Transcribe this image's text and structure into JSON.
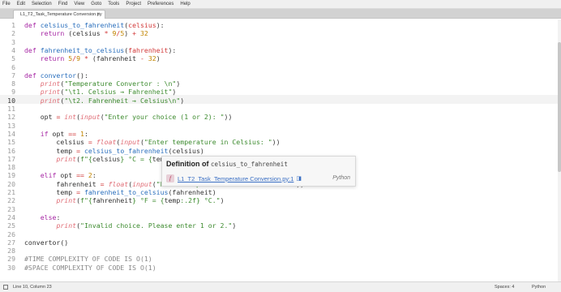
{
  "menu": [
    "File",
    "Edit",
    "Selection",
    "Find",
    "View",
    "Goto",
    "Tools",
    "Project",
    "Preferences",
    "Help"
  ],
  "tab": {
    "label": "L1_T2_Task_Temperature Conversion.py",
    "close": "×"
  },
  "tab_dropdown": "▾",
  "current_line": 10,
  "lines": [
    [
      [
        "kw",
        "def "
      ],
      [
        "fn",
        "celsius_to_fahrenheit"
      ],
      [
        "pl",
        "("
      ],
      [
        "op",
        "celsius"
      ],
      [
        "pl",
        "):"
      ]
    ],
    [
      [
        "pl",
        "    "
      ],
      [
        "kw",
        "return "
      ],
      [
        "pl",
        "(celsius "
      ],
      [
        "op",
        "* "
      ],
      [
        "nu",
        "9"
      ],
      [
        "op",
        "/"
      ],
      [
        "nu",
        "5"
      ],
      [
        "pl",
        ") "
      ],
      [
        "op",
        "+ "
      ],
      [
        "nu",
        "32"
      ]
    ],
    [],
    [
      [
        "kw",
        "def "
      ],
      [
        "fn",
        "fahrenheit_to_celsius"
      ],
      [
        "pl",
        "("
      ],
      [
        "op",
        "fahrenheit"
      ],
      [
        "pl",
        "):"
      ]
    ],
    [
      [
        "pl",
        "    "
      ],
      [
        "kw",
        "return "
      ],
      [
        "nu",
        "5"
      ],
      [
        "op",
        "/"
      ],
      [
        "nu",
        "9 "
      ],
      [
        "op",
        "* "
      ],
      [
        "pl",
        "(fahrenheit "
      ],
      [
        "op",
        "- "
      ],
      [
        "nu",
        "32"
      ],
      [
        "pl",
        ")"
      ]
    ],
    [],
    [
      [
        "kw",
        "def "
      ],
      [
        "fn",
        "convertor"
      ],
      [
        "pl",
        "():"
      ]
    ],
    [
      [
        "pl",
        "    "
      ],
      [
        "bi",
        "print"
      ],
      [
        "pl",
        "("
      ],
      [
        "st",
        "\"Temperature Convertor : \\n\""
      ],
      [
        "pl",
        ")"
      ]
    ],
    [
      [
        "pl",
        "    "
      ],
      [
        "bi",
        "print"
      ],
      [
        "pl",
        "("
      ],
      [
        "st",
        "\"\\t1. Celsius → Fahrenheit\""
      ],
      [
        "pl",
        ")"
      ]
    ],
    [
      [
        "pl",
        "    "
      ],
      [
        "bi",
        "print"
      ],
      [
        "pl",
        "("
      ],
      [
        "st",
        "\"\\t2. Fahrenheit → Celsius\\n\""
      ],
      [
        "pl",
        ")"
      ]
    ],
    [],
    [
      [
        "pl",
        "    opt "
      ],
      [
        "op",
        "= "
      ],
      [
        "bi",
        "int"
      ],
      [
        "pl",
        "("
      ],
      [
        "bi",
        "input"
      ],
      [
        "pl",
        "("
      ],
      [
        "st",
        "\"Enter your choice (1 or 2): \""
      ],
      [
        "pl",
        "))"
      ]
    ],
    [],
    [
      [
        "pl",
        "    "
      ],
      [
        "kw",
        "if "
      ],
      [
        "pl",
        "opt "
      ],
      [
        "op",
        "== "
      ],
      [
        "nu",
        "1"
      ],
      [
        "pl",
        ":"
      ]
    ],
    [
      [
        "pl",
        "        celsius "
      ],
      [
        "op",
        "= "
      ],
      [
        "bi",
        "float"
      ],
      [
        "pl",
        "("
      ],
      [
        "bi",
        "input"
      ],
      [
        "pl",
        "("
      ],
      [
        "st",
        "\"Enter temperature in Celsius: \""
      ],
      [
        "pl",
        "))"
      ]
    ],
    [
      [
        "pl",
        "        temp "
      ],
      [
        "op",
        "= "
      ],
      [
        "fn",
        "celsius_to_fahrenheit"
      ],
      [
        "pl",
        "(celsius)"
      ]
    ],
    [
      [
        "pl",
        "        "
      ],
      [
        "bi",
        "print"
      ],
      [
        "pl",
        "("
      ],
      [
        "st",
        "f\"{"
      ],
      [
        "pl",
        "celsius"
      ],
      [
        "st",
        "} °C = {"
      ],
      [
        "pl",
        "tem"
      ]
    ],
    [],
    [
      [
        "pl",
        "    "
      ],
      [
        "kw",
        "elif "
      ],
      [
        "pl",
        "opt "
      ],
      [
        "op",
        "== "
      ],
      [
        "nu",
        "2"
      ],
      [
        "pl",
        ":"
      ]
    ],
    [
      [
        "pl",
        "        fahrenheit "
      ],
      [
        "op",
        "= "
      ],
      [
        "bi",
        "float"
      ],
      [
        "pl",
        "("
      ],
      [
        "bi",
        "input"
      ],
      [
        "pl",
        "("
      ],
      [
        "st",
        "\"Enter temperature in Fahrenheit: \""
      ],
      [
        "pl",
        "))"
      ]
    ],
    [
      [
        "pl",
        "        temp "
      ],
      [
        "op",
        "= "
      ],
      [
        "fn",
        "fahrenheit_to_celsius"
      ],
      [
        "pl",
        "(fahrenheit)"
      ]
    ],
    [
      [
        "pl",
        "        "
      ],
      [
        "bi",
        "print"
      ],
      [
        "pl",
        "("
      ],
      [
        "st",
        "f\"{"
      ],
      [
        "pl",
        "fahrenheit"
      ],
      [
        "st",
        "} °F = {"
      ],
      [
        "pl",
        "temp"
      ],
      [
        "st",
        ":.2f} °C.\""
      ],
      [
        "pl",
        ")"
      ]
    ],
    [],
    [
      [
        "pl",
        "    "
      ],
      [
        "kw",
        "else"
      ],
      [
        "pl",
        ":"
      ]
    ],
    [
      [
        "pl",
        "        "
      ],
      [
        "bi",
        "print"
      ],
      [
        "pl",
        "("
      ],
      [
        "st",
        "\"Invalid choice. Please enter 1 or 2.\""
      ],
      [
        "pl",
        ")"
      ]
    ],
    [],
    [
      [
        "pl",
        "convertor()"
      ]
    ],
    [],
    [
      [
        "cm",
        "#TIME COMPLEXITY OF CODE IS O(1)"
      ]
    ],
    [
      [
        "cm",
        "#SPACE COMPLEXITY OF CODE IS O(1)"
      ]
    ]
  ],
  "popup": {
    "title": "Definition of",
    "symbol": "celsius_to_fahrenheit",
    "kind_icon": "f",
    "link": "L1_T2_Task_Temperature Conversion.py:1",
    "open_icon": "◨",
    "language": "Python"
  },
  "status": {
    "position": "Line 10, Column 23",
    "spaces": "Spaces: 4",
    "language": "Python"
  }
}
